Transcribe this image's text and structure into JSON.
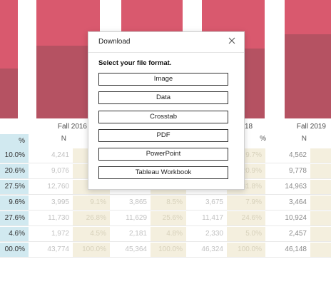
{
  "dialog": {
    "title": "Download",
    "prompt": "Select your file format.",
    "close_icon": "close-icon",
    "options": [
      "Image",
      "Data",
      "Crosstab",
      "PDF",
      "PowerPoint",
      "Tableau Workbook"
    ],
    "highlighted_option": "Crosstab",
    "highlight_color": "#f2ec1f"
  },
  "colors": {
    "bar": "#d9596e",
    "bar_dark": "#b55262",
    "first_col_bg": "#d1e9f0",
    "pct_col_bg": "#f4efde"
  },
  "table": {
    "first_col_header": "%",
    "semester_headers": [
      "Fall 2016",
      "18",
      "Fall 2019"
    ],
    "n_header": "N",
    "pct_header": "%",
    "first_col": [
      "10.0%",
      "20.6%",
      "27.5%",
      "9.6%",
      "27.6%",
      "4.6%",
      "00.0%"
    ],
    "rows": [
      [
        "4,241",
        "",
        "",
        "",
        "",
        "9.7%",
        "4,562"
      ],
      [
        "9,076",
        "",
        "",
        "",
        "",
        "20.9%",
        "9,778"
      ],
      [
        "12,760",
        "",
        "",
        "",
        "",
        "31.8%",
        "14,963"
      ],
      [
        "3,995",
        "9.1%",
        "3,865",
        "8.5%",
        "3,675",
        "7.9%",
        "3,464"
      ],
      [
        "11,730",
        "26.8%",
        "11,629",
        "25.6%",
        "11,417",
        "24.6%",
        "10,924"
      ],
      [
        "1,972",
        "4.5%",
        "2,181",
        "4.8%",
        "2,330",
        "5.0%",
        "2,457"
      ],
      [
        "43,774",
        "100.0%",
        "45,364",
        "100.0%",
        "46,324",
        "100.0%",
        "46,148"
      ]
    ]
  }
}
